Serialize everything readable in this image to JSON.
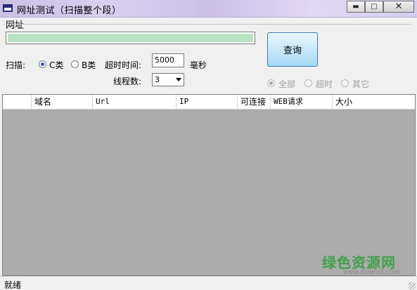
{
  "window": {
    "title": "网址测试（扫描整个段）"
  },
  "url_section": {
    "label": "网址",
    "value": ""
  },
  "scan": {
    "label": "扫描:",
    "options": [
      {
        "label": "C类",
        "checked": true
      },
      {
        "label": "B类",
        "checked": false
      }
    ]
  },
  "timeout": {
    "label": "超时时间:",
    "value": "5000",
    "unit": "毫秒"
  },
  "threads": {
    "label": "线程数:",
    "selected": "3"
  },
  "query_button": {
    "label": "查询"
  },
  "filter": {
    "options": [
      {
        "label": "全部",
        "checked": true
      },
      {
        "label": "超时",
        "checked": false
      },
      {
        "label": "其它",
        "checked": false
      }
    ]
  },
  "grid": {
    "columns": [
      "",
      "域名",
      "Url",
      "IP",
      "可连接",
      "WEB请求",
      "大小"
    ]
  },
  "status": {
    "text": "就绪"
  },
  "watermark": {
    "text": "绿色资源网",
    "url": "www.downcc.com"
  },
  "colors": {
    "grid_bg": "#ababab",
    "url_fill": "#b9e3c4",
    "accent": "#2a5cb8"
  }
}
